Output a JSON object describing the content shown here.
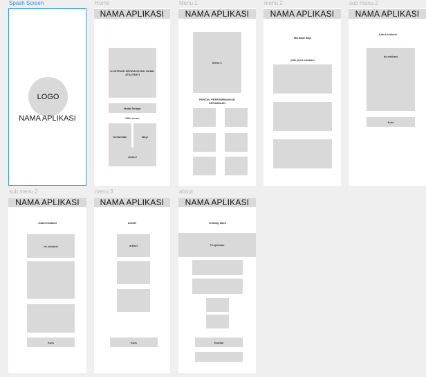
{
  "labels": {
    "splash": "Spash Screen",
    "home": "Home",
    "menu1": "Menu 1",
    "menu2": "menu 2",
    "submenu2a": "sub menu 2",
    "submenu2b": "sub menu 2",
    "menu3": "menu 3",
    "about": "about"
  },
  "app_name": "NAMA APLIKASI",
  "splash": {
    "logo": "LOGO"
  },
  "home": {
    "illustration": "ILUSTRASI SEORANG IBU HAMIL ATAU BAYI",
    "start": "Mulai Belajar",
    "pilih": "Pilih menu",
    "kehamilan": "Kehamilan",
    "bayi": "Bayi",
    "artikel": "Artikel"
  },
  "menu1": {
    "hero": "Menu 1",
    "caption": "PANTAU PERKEMBANGAN KEHAMILAN"
  },
  "menu2": {
    "title": "Merawat Bayi",
    "subtitle": "pilih jenis edukasi"
  },
  "submenu2a": {
    "title": "Judul edukasi",
    "content": "Isi edukasi",
    "kuis": "Kuis"
  },
  "submenu2b": {
    "title": "Judul edukasi",
    "content": "Isi edukasi",
    "kuis": "Kuis"
  },
  "menu3": {
    "title": "Artikel",
    "content": "artikel",
    "kuis": "Kuis"
  },
  "about": {
    "title": "tentang kami",
    "content": "Penjelasan",
    "kontak": "Kontak"
  }
}
